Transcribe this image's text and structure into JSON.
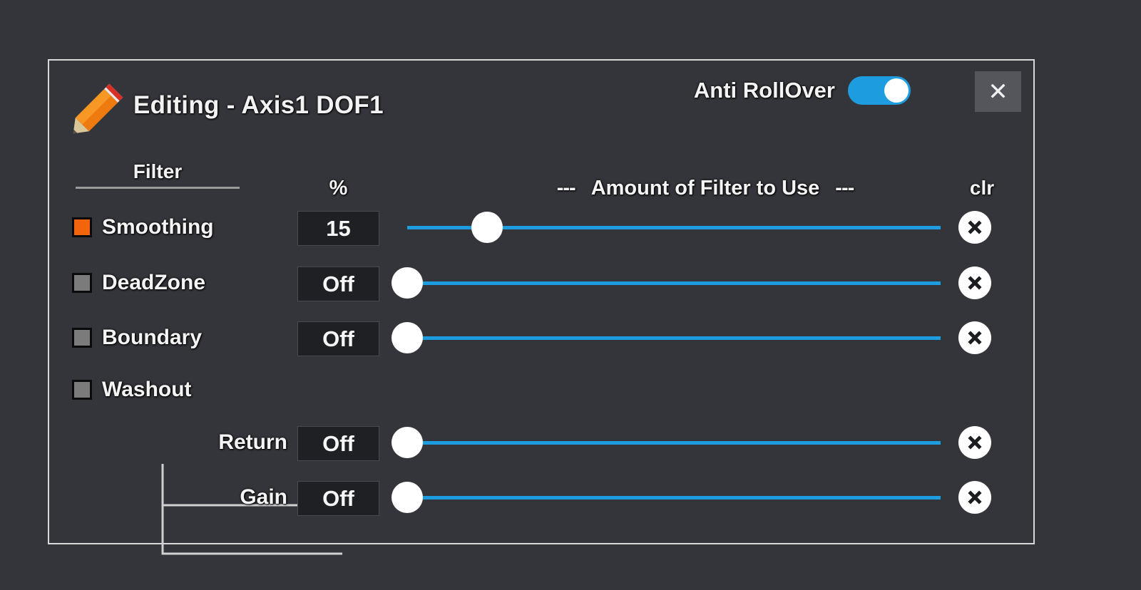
{
  "window": {
    "title": "Editing - Axis1 DOF1",
    "icon": "pencil-icon",
    "close_label": "✕"
  },
  "anti_rollover": {
    "label": "Anti RollOver",
    "state": "on"
  },
  "headers": {
    "filter": "Filter",
    "percent": "%",
    "amount_dash_left": "---",
    "amount": "Amount of Filter to Use",
    "amount_dash_right": "---",
    "clr": "clr"
  },
  "colors": {
    "accent_blue": "#1e9ce0",
    "checkbox_on": "#f2650d",
    "checkbox_off": "#7b7b7b",
    "panel_bg": "#34353a",
    "value_bg": "#1f2024"
  },
  "rows": [
    {
      "name": "Smoothing",
      "checkbox": "on",
      "value": "15",
      "slider_percent": 15,
      "clr": "clear-icon",
      "child": false
    },
    {
      "name": "DeadZone",
      "checkbox": "off",
      "value": "Off",
      "slider_percent": 0,
      "clr": "clear-icon",
      "child": false
    },
    {
      "name": "Boundary",
      "checkbox": "off",
      "value": "Off",
      "slider_percent": 0,
      "clr": "clear-icon",
      "child": false
    },
    {
      "name": "Washout",
      "checkbox": "off",
      "value": null,
      "slider_percent": null,
      "clr": null,
      "child": false
    },
    {
      "name": "Return",
      "checkbox": null,
      "value": "Off",
      "slider_percent": 0,
      "clr": "clear-icon",
      "child": true
    },
    {
      "name": "Gain",
      "checkbox": null,
      "value": "Off",
      "slider_percent": 0,
      "clr": "clear-icon",
      "child": true
    }
  ]
}
